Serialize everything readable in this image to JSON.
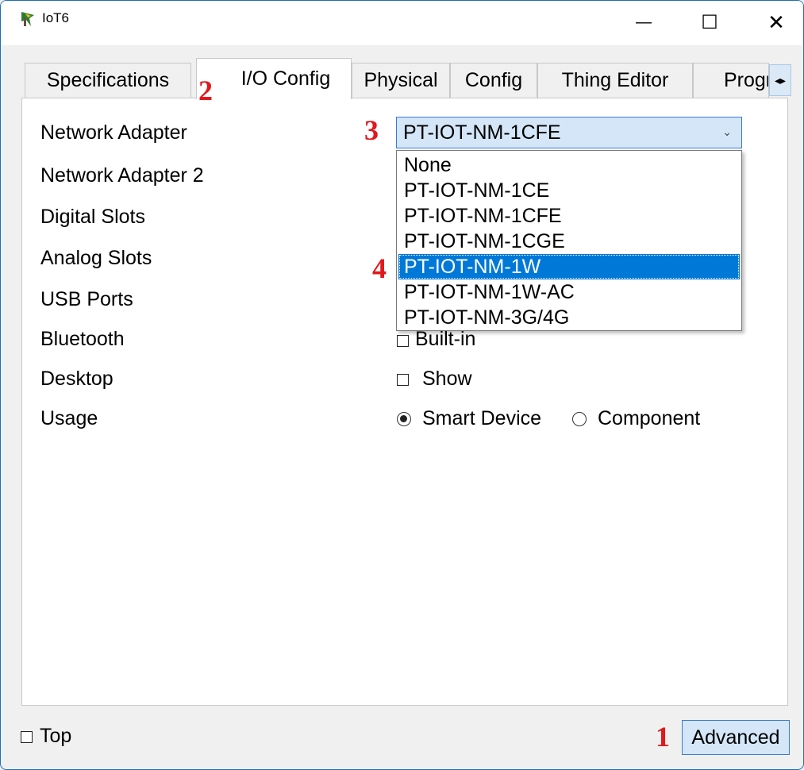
{
  "window": {
    "title": "IoT6",
    "minimize_glyph": "—",
    "maximize_glyph": "☐",
    "close_glyph": "✕"
  },
  "tabs": [
    {
      "label": "Specifications",
      "active": false
    },
    {
      "label": "I/O Config",
      "active": true
    },
    {
      "label": "Physical",
      "active": false
    },
    {
      "label": "Config",
      "active": false
    },
    {
      "label": "Thing Editor",
      "active": false
    },
    {
      "label": "Progra",
      "active": false
    }
  ],
  "tab_scroll_glyph": "◂▸",
  "io_config": {
    "labels": {
      "network_adapter": "Network Adapter",
      "network_adapter_2": "Network Adapter 2",
      "digital_slots": "Digital Slots",
      "analog_slots": "Analog Slots",
      "usb_ports": "USB Ports",
      "bluetooth": "Bluetooth",
      "desktop": "Desktop",
      "usage": "Usage"
    },
    "network_adapter_value": "PT-IOT-NM-1CFE",
    "dropdown_options": [
      "None",
      "PT-IOT-NM-1CE",
      "PT-IOT-NM-1CFE",
      "PT-IOT-NM-1CGE",
      "PT-IOT-NM-1W",
      "PT-IOT-NM-1W-AC",
      "PT-IOT-NM-3G/4G"
    ],
    "dropdown_highlighted": "PT-IOT-NM-1W",
    "bluetooth_checkbox_label": "Built-in",
    "desktop_checkbox_label": "Show",
    "usage_options": {
      "smart_device": "Smart Device",
      "component": "Component"
    },
    "usage_selected": "Smart Device"
  },
  "footer": {
    "top_checkbox_label": "Top",
    "advanced_button_label": "Advanced"
  },
  "annotations": {
    "step1": "1",
    "step2": "2",
    "step3": "3",
    "step4": "4"
  },
  "colors": {
    "annotation_red": "#e0191e",
    "selection_blue": "#0078d7",
    "focus_border": "#3a7bd5"
  }
}
